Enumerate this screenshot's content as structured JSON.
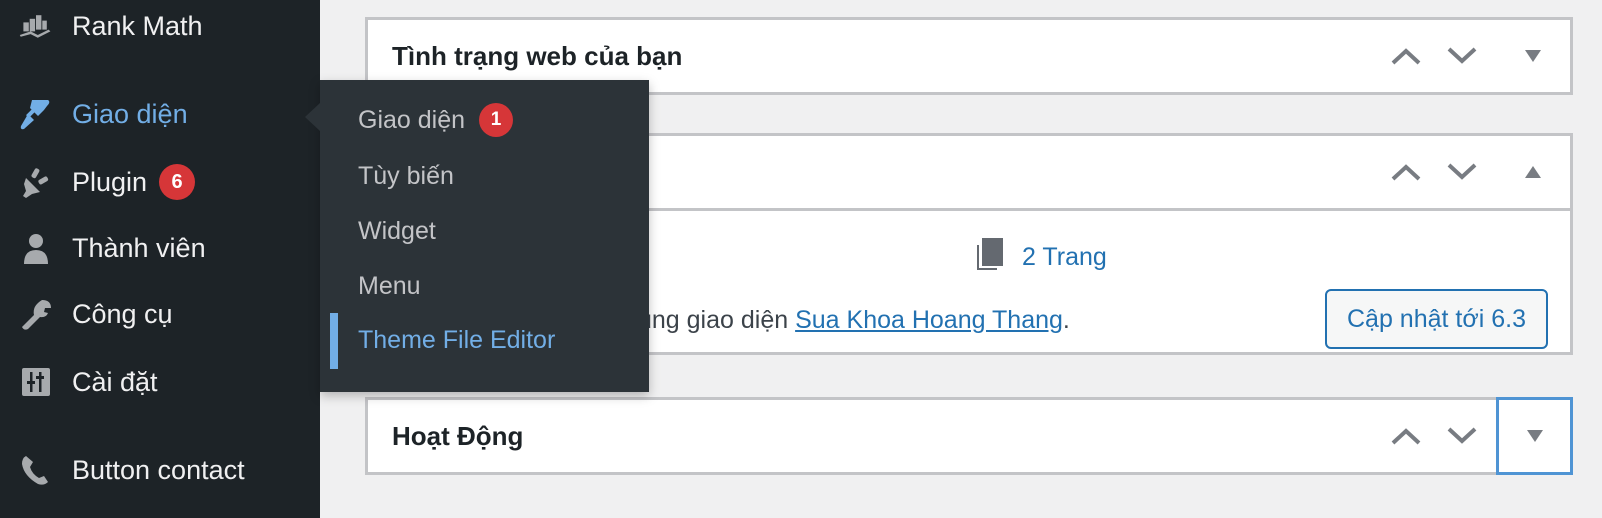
{
  "sidebar": {
    "items": [
      {
        "label": "Rank Math",
        "icon": "rank-math-icon"
      },
      {
        "label": "Giao diện",
        "icon": "paintbrush-icon",
        "active": true
      },
      {
        "label": "Plugin",
        "icon": "plugin-icon",
        "badge": "6"
      },
      {
        "label": "Thành viên",
        "icon": "user-icon"
      },
      {
        "label": "Công cụ",
        "icon": "wrench-icon"
      },
      {
        "label": "Cài đặt",
        "icon": "settings-icon"
      },
      {
        "label": "Button contact",
        "icon": "phone-icon"
      }
    ]
  },
  "submenu": {
    "items": [
      {
        "label": "Giao diện",
        "badge": "1"
      },
      {
        "label": "Tùy biến"
      },
      {
        "label": "Widget"
      },
      {
        "label": "Menu"
      },
      {
        "label": "Theme File Editor",
        "current": true
      }
    ]
  },
  "panels": {
    "site_health": {
      "title": "Tình trạng web của bạn"
    },
    "at_a_glance": {
      "title": "",
      "pages_count": "2 Trang",
      "theme_prefix": "ụng giao diện ",
      "theme_name": "Sua Khoa Hoang Thang",
      "theme_suffix": ".",
      "update_button": "Cập nhật tới 6.3"
    },
    "activity": {
      "title": "Hoạt Động"
    }
  },
  "colors": {
    "accent": "#72aee6",
    "link": "#2271b1",
    "badge": "#d63638",
    "sidebar_bg": "#1d2327",
    "submenu_bg": "#2c3338"
  }
}
